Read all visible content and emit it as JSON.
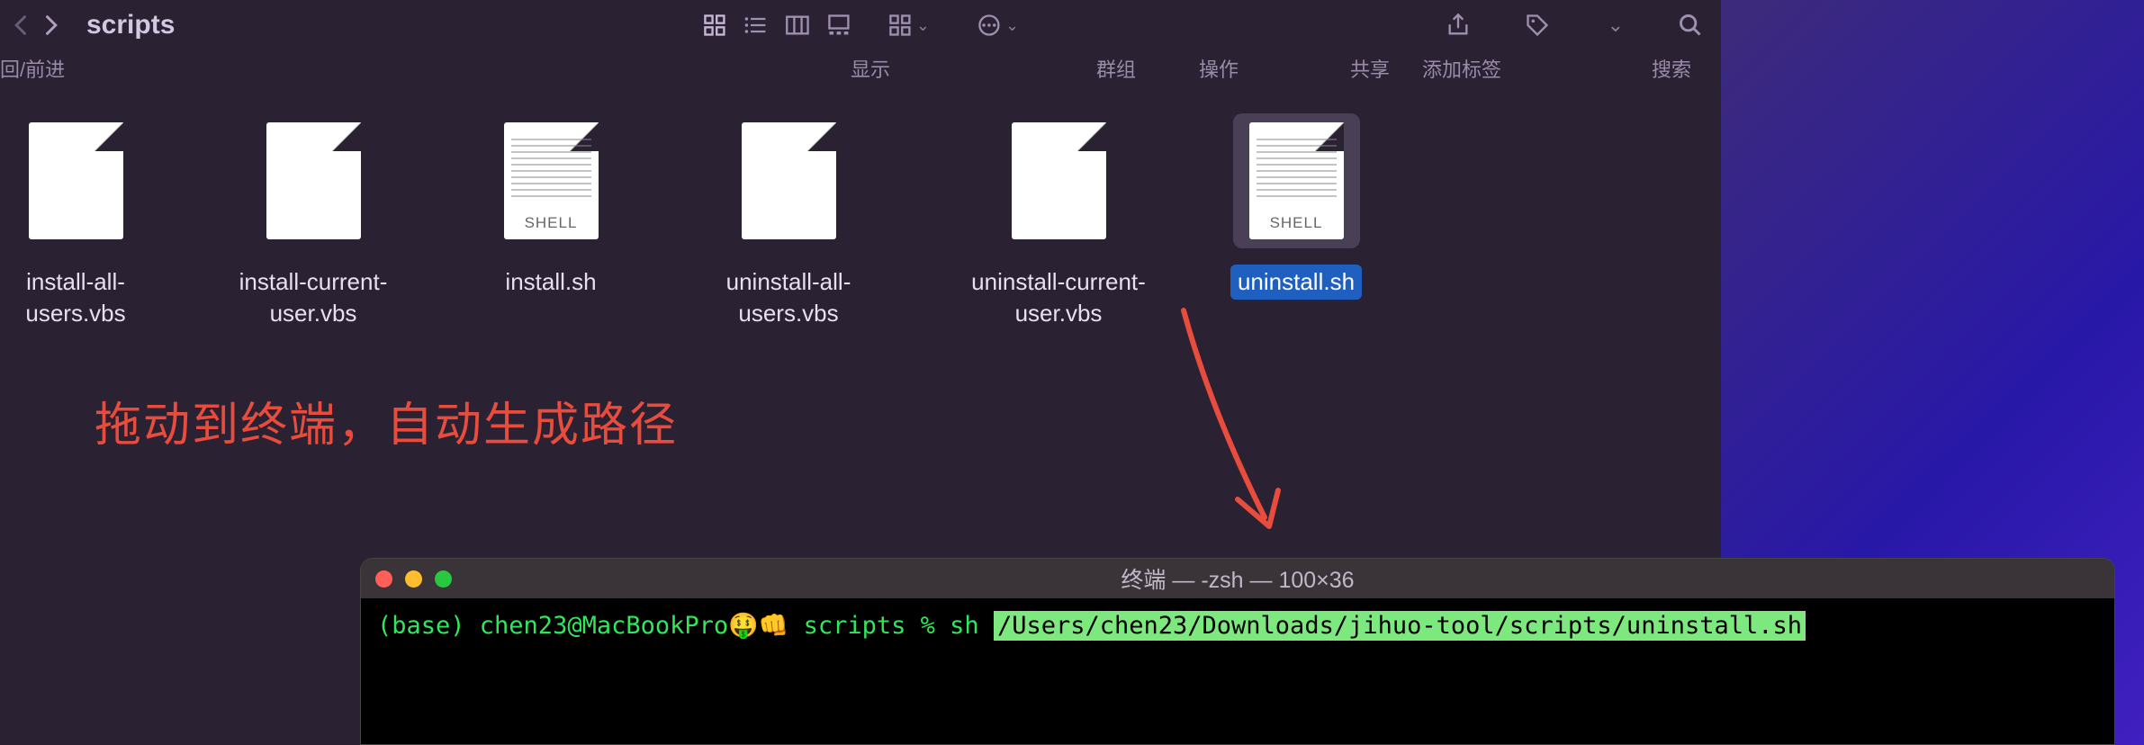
{
  "finder": {
    "title": "scripts",
    "labels": {
      "back": "回/前进",
      "view": "显示",
      "group": "群组",
      "action": "操作",
      "share": "共享",
      "tag": "添加标签",
      "search": "搜索"
    },
    "files": [
      {
        "name": "install-all-users.vbs",
        "kind": "vbs",
        "selected": false
      },
      {
        "name": "install-current-user.vbs",
        "kind": "vbs",
        "selected": false
      },
      {
        "name": "install.sh",
        "kind": "shell",
        "selected": false
      },
      {
        "name": "uninstall-all-users.vbs",
        "kind": "vbs",
        "selected": false
      },
      {
        "name": "uninstall-current-user.vbs",
        "kind": "vbs",
        "selected": false
      },
      {
        "name": "uninstall.sh",
        "kind": "shell",
        "selected": true
      }
    ],
    "shell_label": "SHELL"
  },
  "annotation": {
    "text": "拖动到终端，自动生成路径",
    "color": "#e74c3c"
  },
  "terminal": {
    "title": "终端 — -zsh — 100×36",
    "prompt": "(base) chen23@MacBookPro🤑👊 scripts % sh ",
    "path": "/Users/chen23/Downloads/jihuo-tool/scripts/uninstall.sh"
  }
}
